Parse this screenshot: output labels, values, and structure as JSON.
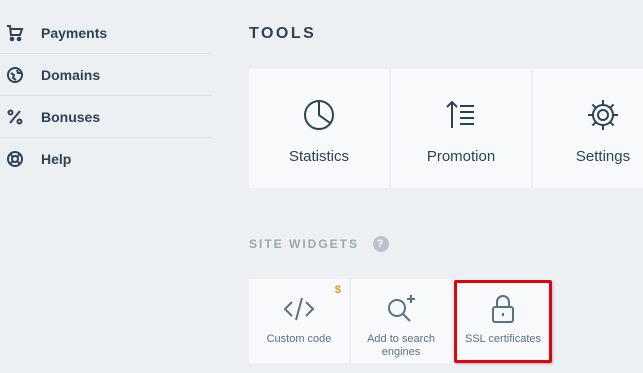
{
  "sidebar": {
    "items": [
      {
        "label": "Payments",
        "icon": "cart-icon"
      },
      {
        "label": "Domains",
        "icon": "globe-icon"
      },
      {
        "label": "Bonuses",
        "icon": "percent-icon"
      },
      {
        "label": "Help",
        "icon": "lifebuoy-icon"
      }
    ]
  },
  "tools": {
    "title": "TOOLS",
    "items": [
      {
        "label": "Statistics",
        "icon": "pie-chart-icon"
      },
      {
        "label": "Promotion",
        "icon": "sort-list-icon"
      },
      {
        "label": "Settings",
        "icon": "gear-icon"
      }
    ]
  },
  "widgets": {
    "title": "SITE WIDGETS",
    "help_glyph": "?",
    "items": [
      {
        "label": "Custom code",
        "icon": "code-icon",
        "badge": "$"
      },
      {
        "label": "Add to search engines",
        "icon": "search-plus-icon"
      },
      {
        "label": "SSL certificates",
        "icon": "lock-icon"
      }
    ]
  },
  "colors": {
    "background": "#edf0f2",
    "card": "#f8f9fa",
    "text": "#2d4257",
    "muted": "#9aa7b1",
    "badge": "#d29b2b",
    "highlight": "#e3000f"
  }
}
